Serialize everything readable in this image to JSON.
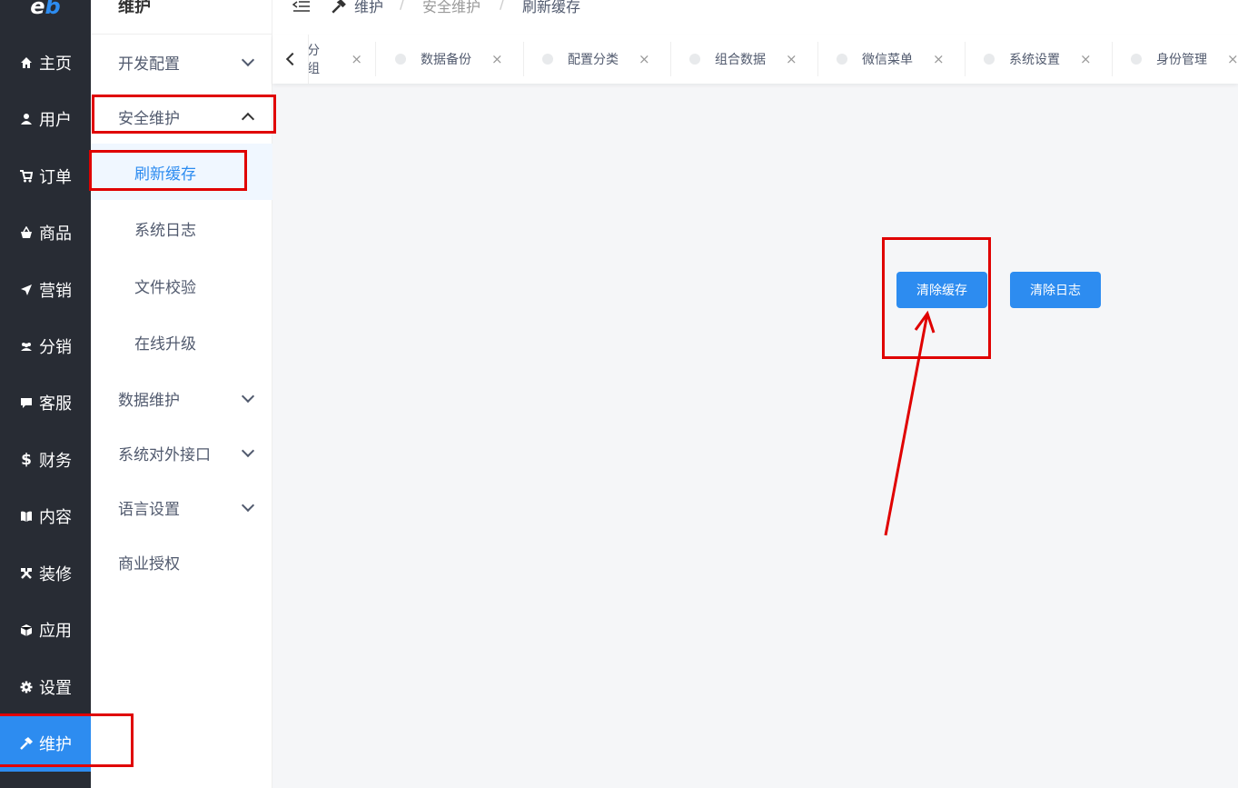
{
  "logo": {
    "text_e": "e",
    "text_b": "b"
  },
  "primary_nav": [
    {
      "label": "主页",
      "icon": "home-icon"
    },
    {
      "label": "用户",
      "icon": "user-icon"
    },
    {
      "label": "订单",
      "icon": "cart-icon"
    },
    {
      "label": "商品",
      "icon": "basket-icon"
    },
    {
      "label": "营销",
      "icon": "send-icon"
    },
    {
      "label": "分销",
      "icon": "group-icon"
    },
    {
      "label": "客服",
      "icon": "chat-icon"
    },
    {
      "label": "财务",
      "icon": "dollar-icon"
    },
    {
      "label": "内容",
      "icon": "book-icon"
    },
    {
      "label": "装修",
      "icon": "tools-icon"
    },
    {
      "label": "应用",
      "icon": "cube-icon"
    },
    {
      "label": "设置",
      "icon": "gear-icon"
    },
    {
      "label": "维护",
      "icon": "hammer-icon",
      "active": true
    }
  ],
  "secondary_nav": {
    "title": "维护",
    "items": [
      {
        "label": "开发配置"
      },
      {
        "label": "安全维护"
      },
      {
        "label": "刷新缓存"
      },
      {
        "label": "系统日志"
      },
      {
        "label": "文件校验"
      },
      {
        "label": "在线升级"
      },
      {
        "label": "数据维护"
      },
      {
        "label": "系统对外接口"
      },
      {
        "label": "语言设置"
      },
      {
        "label": "商业授权"
      }
    ]
  },
  "breadcrumb": {
    "items": [
      "维护",
      "安全维护",
      "刷新缓存"
    ],
    "separator": "/"
  },
  "tabs": [
    {
      "label": "分组"
    },
    {
      "label": "数据备份"
    },
    {
      "label": "配置分类"
    },
    {
      "label": "组合数据"
    },
    {
      "label": "微信菜单"
    },
    {
      "label": "系统设置"
    },
    {
      "label": "身份管理"
    }
  ],
  "tab_close_glyph": "×",
  "actions": {
    "clear_cache": "清除缓存",
    "clear_log": "清除日志"
  },
  "colors": {
    "primary": "#2d8cf0",
    "sidebar_dark": "#282c34",
    "annotation": "#e00000"
  }
}
